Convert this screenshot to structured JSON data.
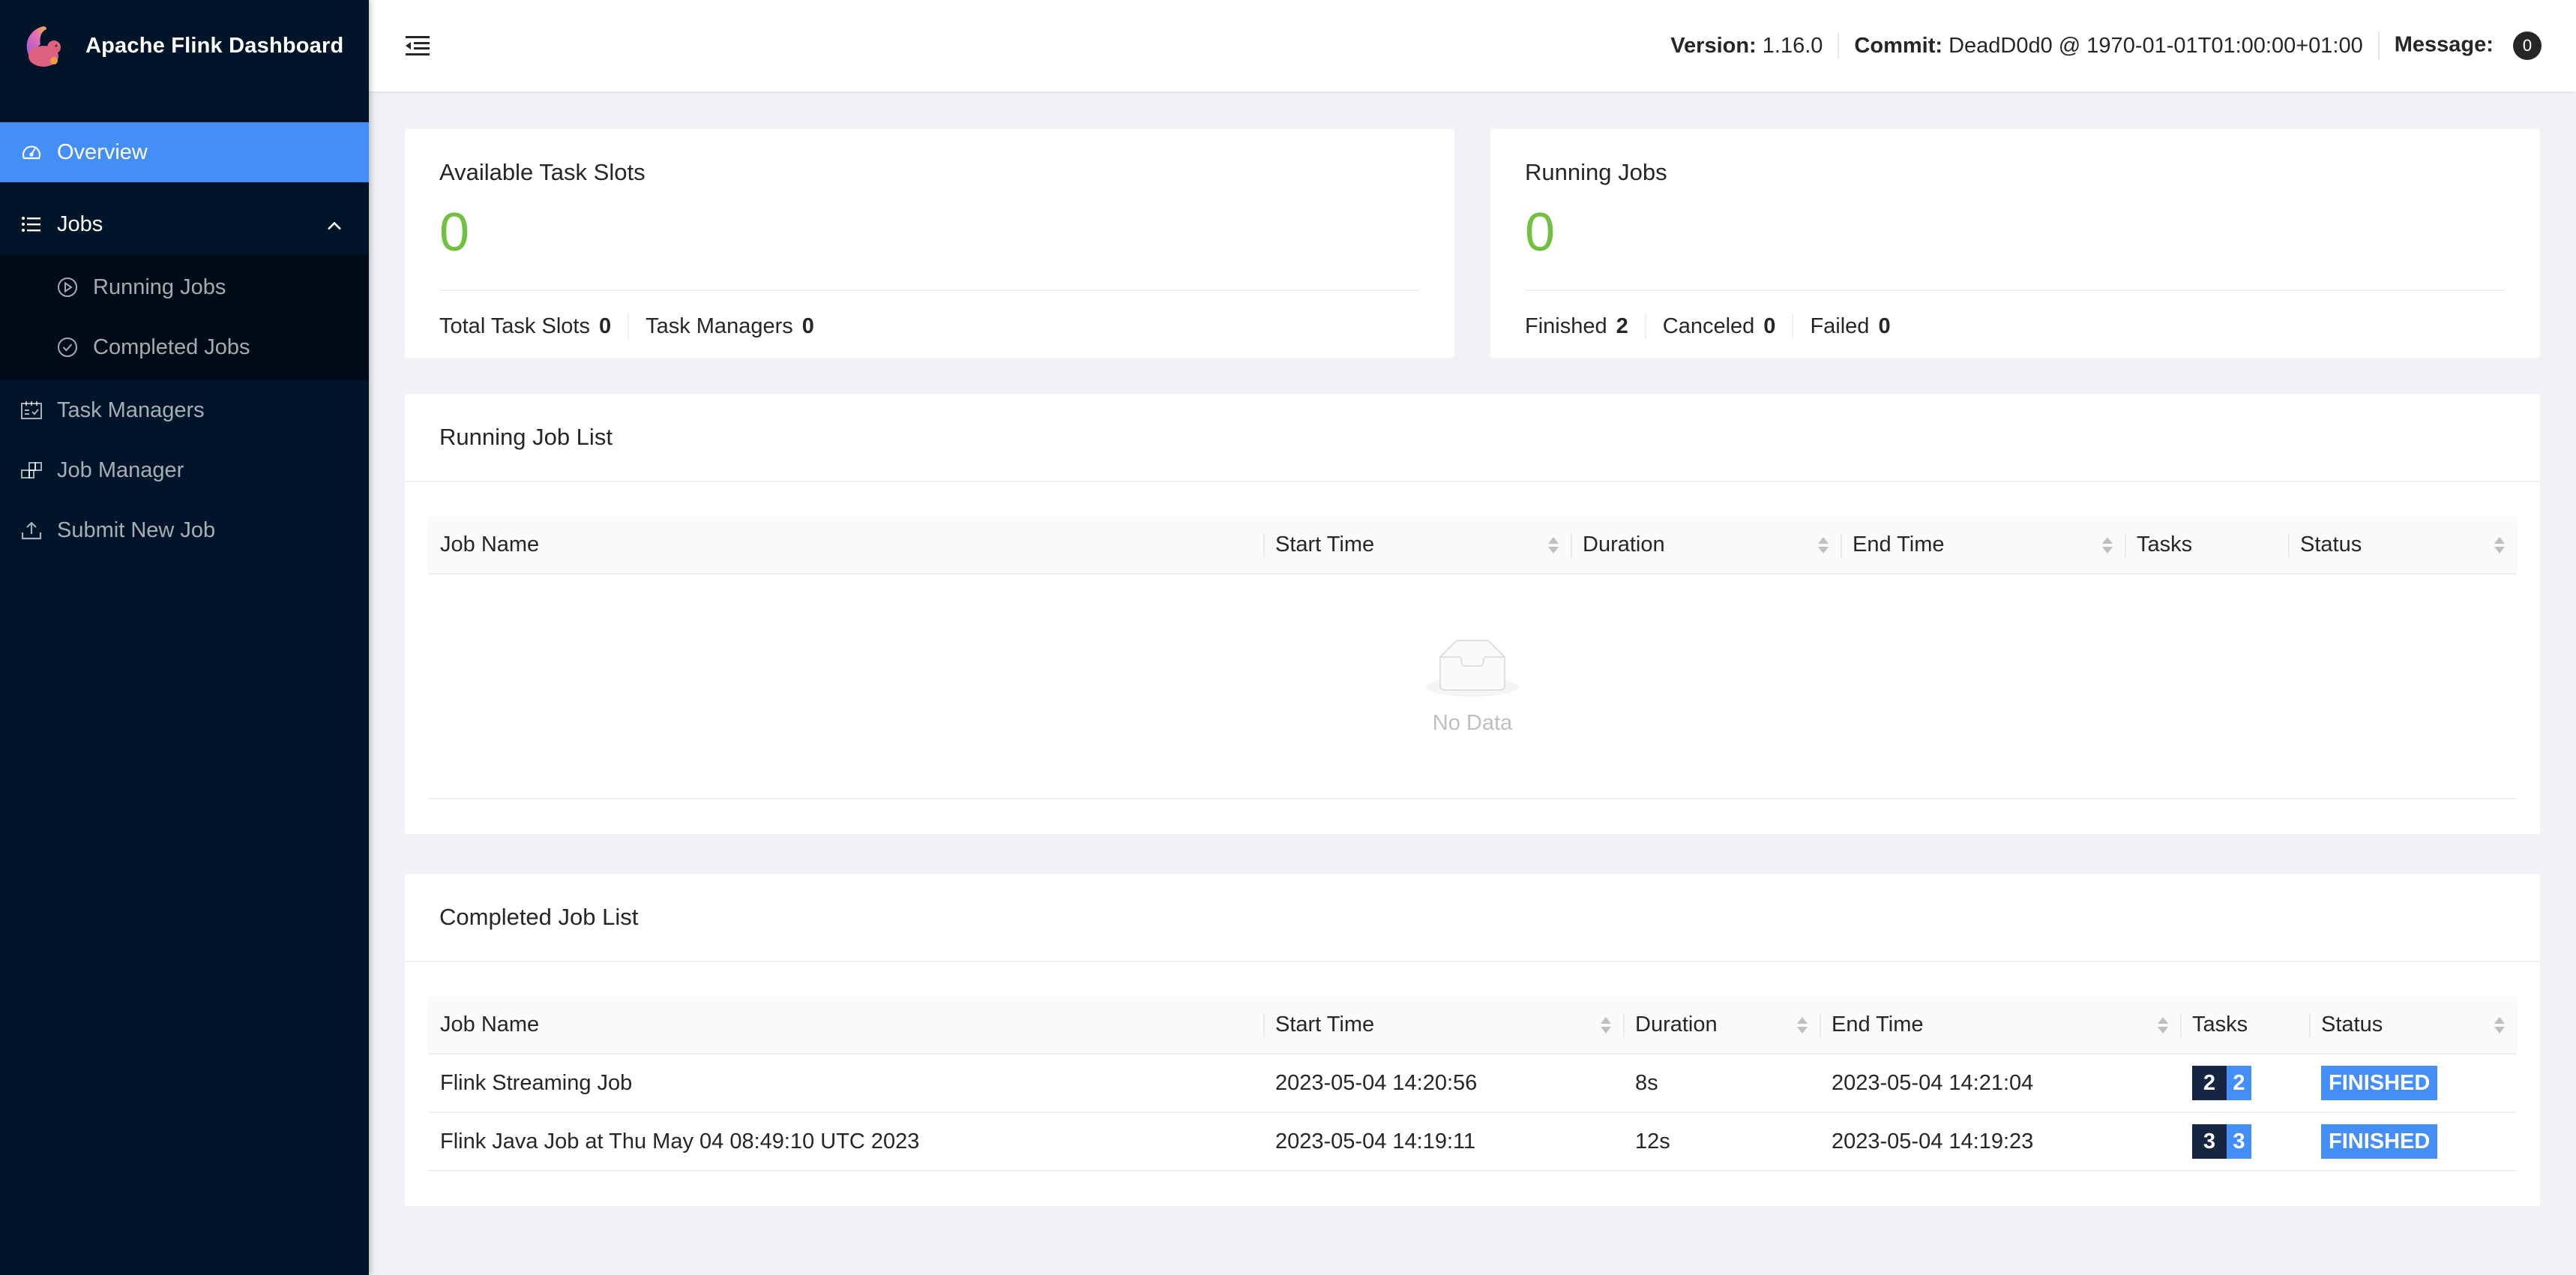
{
  "app": {
    "title": "Apache Flink Dashboard",
    "logo_icon": "flink-squirrel-logo"
  },
  "sidebar": {
    "items": [
      {
        "label": "Overview",
        "icon": "dashboard-icon",
        "active": true
      },
      {
        "label": "Jobs",
        "icon": "unordered-list-icon",
        "expanded": true,
        "children": [
          {
            "label": "Running Jobs",
            "icon": "play-circle-icon"
          },
          {
            "label": "Completed Jobs",
            "icon": "check-circle-icon"
          }
        ]
      },
      {
        "label": "Task Managers",
        "icon": "schedule-icon"
      },
      {
        "label": "Job Manager",
        "icon": "build-icon"
      },
      {
        "label": "Submit New Job",
        "icon": "upload-icon"
      }
    ]
  },
  "header": {
    "collapse_icon": "menu-fold-icon",
    "version_label": "Version:",
    "version_value": "1.16.0",
    "commit_label": "Commit:",
    "commit_value": "DeadD0d0 @ 1970-01-01T01:00:00+01:00",
    "message_label": "Message:",
    "message_count": "0"
  },
  "overview": {
    "task_slots": {
      "title": "Available Task Slots",
      "value": "0",
      "stats": [
        {
          "label": "Total Task Slots",
          "value": "0"
        },
        {
          "label": "Task Managers",
          "value": "0"
        }
      ]
    },
    "running_jobs": {
      "title": "Running Jobs",
      "value": "0",
      "stats": [
        {
          "label": "Finished",
          "value": "2"
        },
        {
          "label": "Canceled",
          "value": "0"
        },
        {
          "label": "Failed",
          "value": "0"
        }
      ]
    }
  },
  "running_job_list": {
    "title": "Running Job List",
    "columns": [
      "Job Name",
      "Start Time",
      "Duration",
      "End Time",
      "Tasks",
      "Status"
    ],
    "rows": [],
    "empty_text": "No Data"
  },
  "completed_job_list": {
    "title": "Completed Job List",
    "columns": [
      "Job Name",
      "Start Time",
      "Duration",
      "End Time",
      "Tasks",
      "Status"
    ],
    "rows": [
      {
        "name": "Flink Streaming Job",
        "start": "2023-05-04 14:20:56",
        "duration": "8s",
        "end": "2023-05-04 14:21:04",
        "tasks_total": "2",
        "tasks_finished": "2",
        "status": "FINISHED"
      },
      {
        "name": "Flink Java Job at Thu May 04 08:49:10 UTC 2023",
        "start": "2023-05-04 14:19:11",
        "duration": "12s",
        "end": "2023-05-04 14:19:23",
        "tasks_total": "3",
        "tasks_finished": "3",
        "status": "FINISHED"
      }
    ]
  },
  "colors": {
    "sidebar_bg": "#001529",
    "accent": "#448ef7",
    "stat_green": "#72c040",
    "tasks_dark": "#152542"
  }
}
